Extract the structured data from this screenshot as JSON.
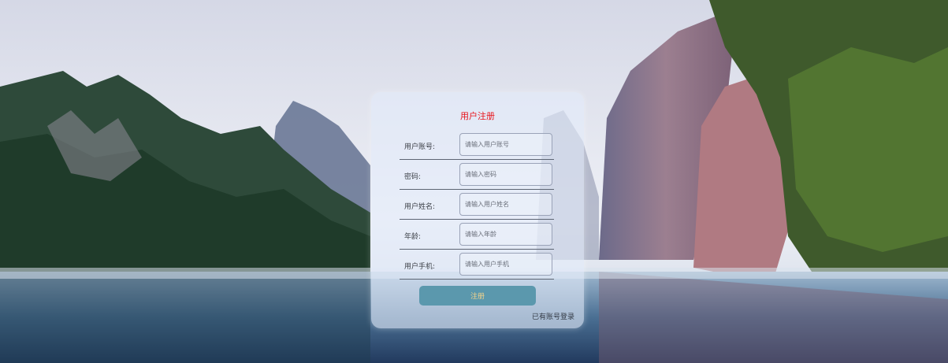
{
  "form": {
    "title": "用户注册",
    "fields": [
      {
        "label": "用户账号:",
        "placeholder": "请输入用户账号"
      },
      {
        "label": "密码:",
        "placeholder": "请输入密码"
      },
      {
        "label": "用户姓名:",
        "placeholder": "请输入用户姓名"
      },
      {
        "label": "年龄:",
        "placeholder": "请输入年龄"
      },
      {
        "label": "用户手机:",
        "placeholder": "请输入用户手机"
      }
    ],
    "submit_label": "注册",
    "login_link": "已有账号登录"
  },
  "colors": {
    "title": "#e8141b",
    "button": "#5b98ad",
    "button_text": "#f4d38a"
  }
}
